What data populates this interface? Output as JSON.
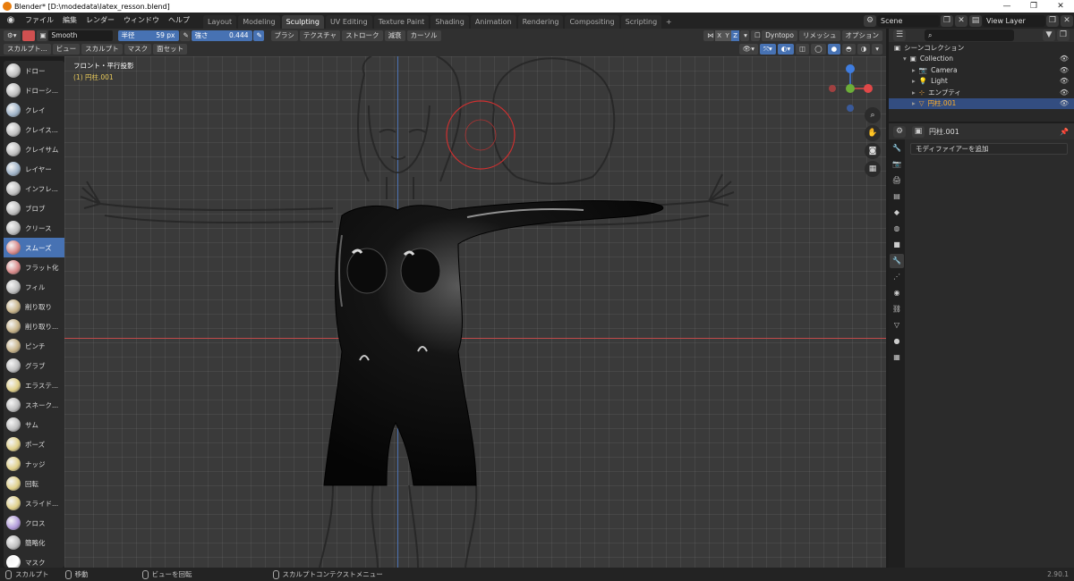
{
  "window": {
    "title": "Blender* [D:\\modedata\\latex_resson.blend]",
    "controls": [
      "—",
      "❐",
      "✕"
    ]
  },
  "menu": {
    "items": [
      "ファイル",
      "編集",
      "レンダー",
      "ウィンドウ",
      "ヘルプ"
    ],
    "workspaces": [
      "Layout",
      "Modeling",
      "Sculpting",
      "UV Editing",
      "Texture Paint",
      "Shading",
      "Animation",
      "Rendering",
      "Compositing",
      "Scripting"
    ],
    "active_workspace": "Sculpting",
    "scene": "Scene",
    "view_layer": "View Layer"
  },
  "tool_header": {
    "tool_name": "Smooth",
    "radius_label": "半径",
    "radius_value": "59 px",
    "strength_label": "強さ",
    "strength_value": "0.444",
    "dropdowns": [
      "ブラシ",
      "テクスチャ",
      "ストローク",
      "減衰",
      "カーソル"
    ],
    "axes": [
      "X",
      "Y",
      "Z"
    ],
    "dyntopo": "Dyntopo",
    "remesh": "リメッシュ",
    "options": "オプション"
  },
  "view_header": {
    "mode": "スカルプト...",
    "menus": [
      "ビュー",
      "スカルプト",
      "マスク",
      "面セット"
    ]
  },
  "viewport": {
    "view_name": "フロント・平行投影",
    "object_info": "(1) 円柱.001"
  },
  "tools": [
    {
      "label": "ドロー",
      "color": "#bfbfbf"
    },
    {
      "label": "ドローシ...",
      "color": "#bfbfbf"
    },
    {
      "label": "クレイ",
      "color": "#9fb3c8"
    },
    {
      "label": "クレイス...",
      "color": "#bfbfbf"
    },
    {
      "label": "クレイサム",
      "color": "#bfbfbf"
    },
    {
      "label": "レイヤー",
      "color": "#9fb3c8"
    },
    {
      "label": "インフレ...",
      "color": "#bfbfbf"
    },
    {
      "label": "ブロブ",
      "color": "#bfbfbf"
    },
    {
      "label": "クリース",
      "color": "#bfbfbf"
    },
    {
      "label": "スムーズ",
      "color": "#d98a8a"
    },
    {
      "label": "フラット化",
      "color": "#d98a8a"
    },
    {
      "label": "フィル",
      "color": "#bfbfbf"
    },
    {
      "label": "削り取り",
      "color": "#c8b48a"
    },
    {
      "label": "削り取り...",
      "color": "#c8b48a"
    },
    {
      "label": "ピンチ",
      "color": "#c8b48a"
    },
    {
      "label": "グラブ",
      "color": "#bfbfbf"
    },
    {
      "label": "エラステ...",
      "color": "#e0d08a"
    },
    {
      "label": "スネーク...",
      "color": "#bfbfbf"
    },
    {
      "label": "サム",
      "color": "#bfbfbf"
    },
    {
      "label": "ポーズ",
      "color": "#e0d08a"
    },
    {
      "label": "ナッジ",
      "color": "#e0d08a"
    },
    {
      "label": "回転",
      "color": "#e0d08a"
    },
    {
      "label": "スライド...",
      "color": "#e0d08a"
    },
    {
      "label": "クロス",
      "color": "#b39ddb"
    },
    {
      "label": "簡略化",
      "color": "#bfbfbf"
    },
    {
      "label": "マスク",
      "color": "#ffffff"
    }
  ],
  "active_tool": "スムーズ",
  "outliner": {
    "root": "シーンコレクション",
    "rows": [
      {
        "label": "Collection",
        "indent": 1
      },
      {
        "label": "Camera",
        "indent": 2
      },
      {
        "label": "Light",
        "indent": 2
      },
      {
        "label": "エンプティ",
        "indent": 2
      },
      {
        "label": "円柱.001",
        "indent": 2
      }
    ],
    "selected": "円柱.001"
  },
  "properties": {
    "object": "円柱.001",
    "add_modifier": "モディファイアーを追加"
  },
  "status": {
    "items": [
      "スカルプト",
      "移動",
      "ビューを回転",
      "スカルプトコンテクストメニュー"
    ],
    "version": "2.90.1"
  },
  "colors": {
    "accent_blue": "#4772b3",
    "selected_orange": "#ffaf29",
    "brush_circle": "#d03030"
  }
}
